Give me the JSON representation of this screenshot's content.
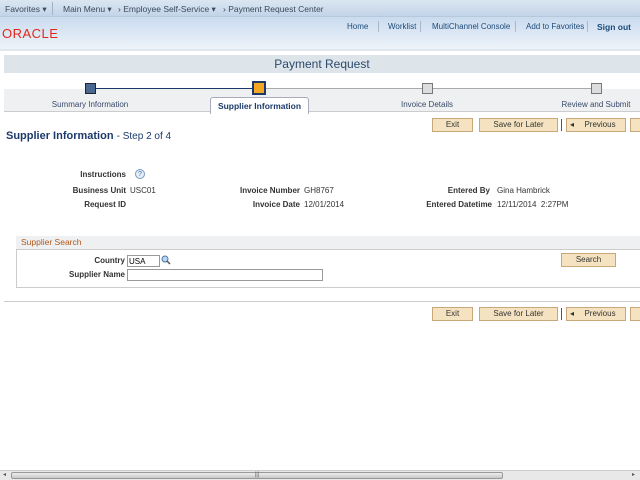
{
  "topnav": {
    "favorites": "Favorites ▾",
    "main_menu": "Main Menu ▾",
    "crumb1": "› Employee Self-Service ▾",
    "crumb2": "› Payment Request Center"
  },
  "header": {
    "links": [
      "Home",
      "Worklist",
      "MultiChannel Console",
      "Add to Favorites"
    ],
    "signout": "Sign out",
    "logo": "ORACLE"
  },
  "page_title": "Payment Request",
  "steps": [
    {
      "label": "Summary Information",
      "state": "complete"
    },
    {
      "label": "Supplier Information",
      "state": "current"
    },
    {
      "label": "Invoice Details",
      "state": "pending"
    },
    {
      "label": "Review and Submit",
      "state": "pending"
    }
  ],
  "toolbar": {
    "exit": "Exit",
    "save": "Save for Later",
    "previous": "Previous"
  },
  "section": {
    "title": "Supplier Information",
    "step": "- Step 2 of 4"
  },
  "info": {
    "instructions": "Instructions",
    "business_unit_label": "Business Unit",
    "business_unit": "USC01",
    "request_id_label": "Request ID",
    "invoice_number_label": "Invoice Number",
    "invoice_number": "GH8767",
    "invoice_date_label": "Invoice Date",
    "invoice_date": "12/01/2014",
    "entered_by_label": "Entered By",
    "entered_by": "Gina Hambrick",
    "entered_dt_label": "Entered Datetime",
    "entered_dt": "12/11/2014  2:27PM"
  },
  "search": {
    "title": "Supplier Search",
    "country_label": "Country",
    "country": "USA",
    "supplier_label": "Supplier Name",
    "supplier": "",
    "button": "Search"
  },
  "colors": {
    "accent": "#f5a623",
    "brand": "#e0281a"
  }
}
